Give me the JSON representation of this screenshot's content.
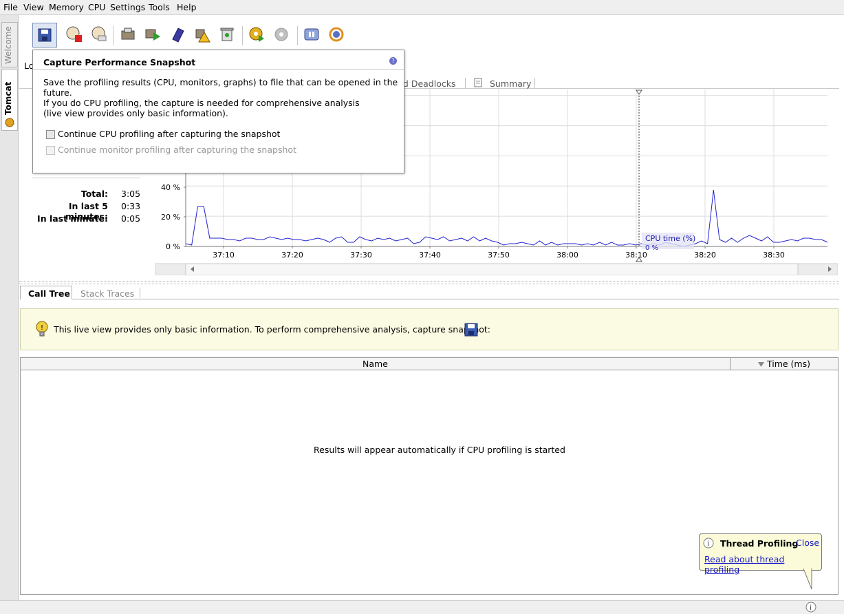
{
  "menu": [
    "File",
    "View",
    "Memory",
    "CPU",
    "Settings",
    "Tools",
    "Help"
  ],
  "side_tabs": {
    "welcome": "Welcome",
    "tomcat": "Tomcat"
  },
  "toolbar_icons": [
    "capture-snapshot-icon",
    "stop-profiling-icon",
    "reset-icon",
    "thread-dump-icon",
    "run-gc-icon",
    "bookmark-icon",
    "warning-icon",
    "recycle-bin-icon",
    "cpu-settings-icon",
    "monitor-settings-icon",
    "pause-icon",
    "refresh-icon"
  ],
  "popup": {
    "title": "Capture Performance Snapshot",
    "line1": "Save the profiling results (CPU, monitors, graphs) to file that can be opened in the future.",
    "line2": "If you do CPU profiling, the capture is needed for comprehensive analysis",
    "line3": "(live view provides only basic information).",
    "option1": "Continue CPU profiling after capturing the snapshot",
    "option2": "Continue monitor profiling after capturing the snapshot"
  },
  "partial_label": "Lo",
  "top_tabs": {
    "deadlocks": "nd Deadlocks",
    "summary": "Summary"
  },
  "stats": {
    "total_label": "Total:",
    "total_value": "3:05",
    "last5_label": "In last 5 minutes:",
    "last5_value": "0:33",
    "last1_label": "In last minute:",
    "last1_value": "0:05"
  },
  "chart_data": {
    "type": "line",
    "series": [
      {
        "name": "CPU time (%)",
        "values": [
          2,
          1,
          29,
          29,
          6,
          6,
          6,
          5,
          5,
          4,
          6,
          6,
          5,
          5,
          7,
          6,
          5,
          6,
          5,
          5,
          4,
          5,
          6,
          5,
          3,
          6,
          7,
          3,
          3,
          7,
          5,
          4,
          6,
          5,
          6,
          4,
          5,
          6,
          2,
          3,
          7,
          6,
          5,
          7,
          4,
          5,
          6,
          4,
          7,
          4,
          6,
          4,
          3,
          1,
          2,
          2,
          3,
          2,
          1,
          4,
          1,
          3,
          1,
          2,
          2,
          2,
          1,
          2,
          1,
          3,
          1,
          3,
          1,
          1,
          2,
          1,
          2,
          1,
          2,
          1,
          3,
          2,
          1,
          0,
          1,
          2,
          4,
          2,
          41,
          5,
          3,
          6,
          3,
          6,
          8,
          6,
          4,
          7,
          3,
          3,
          4,
          5,
          4,
          6,
          6,
          5,
          5,
          3
        ]
      }
    ],
    "x_ticks": [
      "37:10",
      "37:20",
      "37:30",
      "37:40",
      "37:50",
      "38:00",
      "38:10",
      "38:20",
      "38:30"
    ],
    "y_ticks": [
      "0 %",
      "20 %",
      "40 %"
    ],
    "hover_label": "CPU time (%)",
    "hover_value": "0 %",
    "ylim": [
      0,
      100
    ]
  },
  "bottom_tabs": {
    "call_tree": "Call Tree",
    "stack_traces": "Stack Traces"
  },
  "notice": "This live view provides only basic information. To perform comprehensive analysis, capture snapshot:",
  "table": {
    "col_name": "Name",
    "col_time": "Time (ms)",
    "empty": "Results will appear automatically if CPU profiling is started"
  },
  "balloon": {
    "title": "Thread Profiling",
    "close": "Close",
    "link": "Read about thread profiling"
  }
}
